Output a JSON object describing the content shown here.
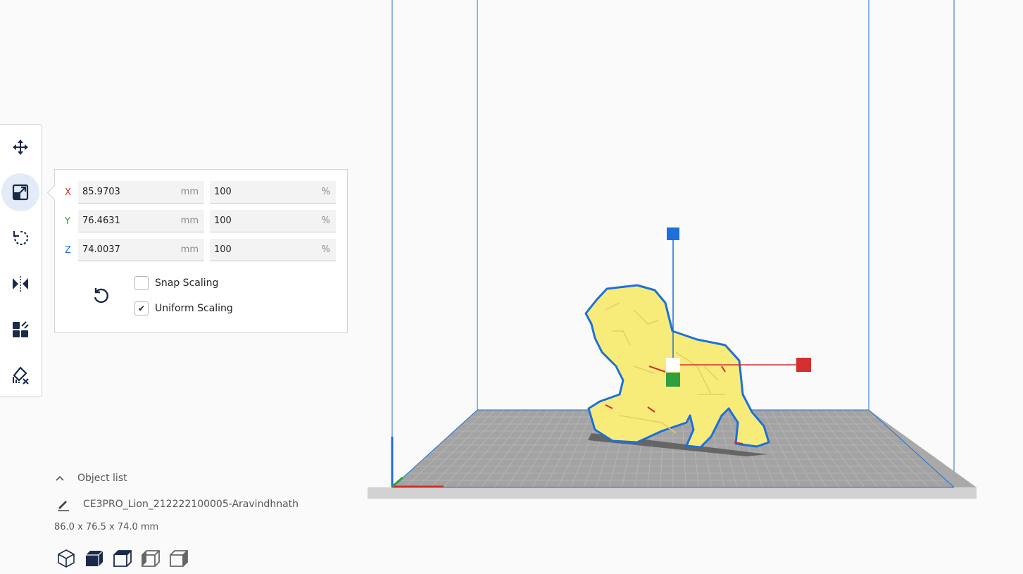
{
  "toolbar": {
    "tools": [
      {
        "name": "move",
        "icon": "move-icon",
        "active": false
      },
      {
        "name": "scale",
        "icon": "scale-icon",
        "active": true
      },
      {
        "name": "rotate",
        "icon": "rotate-icon",
        "active": false
      },
      {
        "name": "mirror",
        "icon": "mirror-icon",
        "active": false
      },
      {
        "name": "per-model-settings",
        "icon": "per-model-settings-icon",
        "active": false
      },
      {
        "name": "support-blocker",
        "icon": "support-blocker-icon",
        "active": false
      }
    ]
  },
  "scale_panel": {
    "x": {
      "label": "X",
      "mm": "85.9703",
      "percent": "100",
      "color": "#d32f2f"
    },
    "y": {
      "label": "Y",
      "mm": "76.4631",
      "percent": "100",
      "color": "#2e9e3f"
    },
    "z": {
      "label": "Z",
      "mm": "74.0037",
      "percent": "100",
      "color": "#1e6fd9"
    },
    "unit_mm": "mm",
    "unit_percent": "%",
    "snap_scaling": {
      "label": "Snap Scaling",
      "checked": false
    },
    "uniform_scaling": {
      "label": "Uniform Scaling",
      "checked": true,
      "mark": "✔"
    }
  },
  "object_list": {
    "header": "Object list",
    "object_name": "CE3PRO_Lion_212222100005-Aravindhnath",
    "dimensions": "86.0 x 76.5 x 74.0 mm"
  },
  "view_buttons": [
    "3d-view-icon",
    "front-view-icon",
    "top-view-icon",
    "left-view-icon",
    "right-view-icon"
  ],
  "colors": {
    "accent": "#1e6fd9",
    "model_fill": "#f7ec7a",
    "model_outline": "#1e6fd9",
    "build_plate": "#a8a8a8",
    "axis_x": "#d32f2f",
    "axis_y": "#2e9e3f",
    "axis_z": "#1e6fd9"
  }
}
